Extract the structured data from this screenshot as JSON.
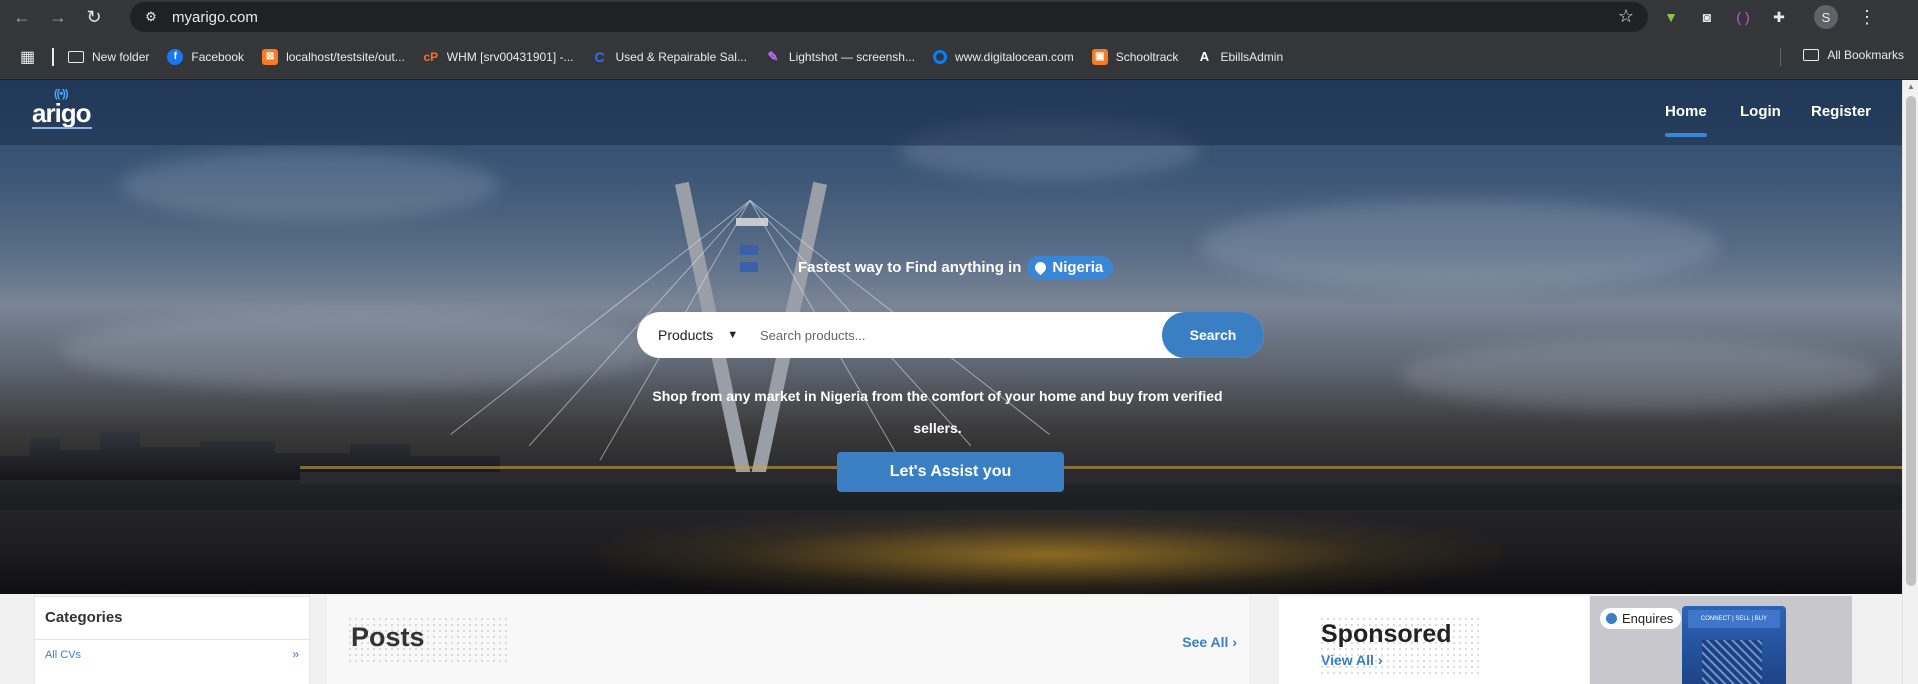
{
  "browser": {
    "url": "myarigo.com",
    "profile_initial": "S",
    "bookmarks": [
      {
        "label": "New folder"
      },
      {
        "label": "Facebook"
      },
      {
        "label": "localhost/testsite/out..."
      },
      {
        "label": "WHM [srv00431901] -..."
      },
      {
        "label": "Used & Repairable Sal..."
      },
      {
        "label": "Lightshot — screensh..."
      },
      {
        "label": "www.digitalocean.com"
      },
      {
        "label": "Schooltrack"
      },
      {
        "label": "EbillsAdmin"
      }
    ],
    "all_bookmarks_label": "All Bookmarks"
  },
  "site": {
    "logo_text": "arigo",
    "nav": [
      {
        "label": "Home"
      },
      {
        "label": "Login"
      },
      {
        "label": "Register"
      }
    ]
  },
  "hero": {
    "tagline": "Fastest way to Find anything in",
    "location": "Nigeria",
    "search_category": "Products",
    "search_placeholder": "Search products...",
    "search_button": "Search",
    "description": "Shop from any market in Nigeria from the comfort of your home and buy from verified sellers.",
    "assist_button": "Let's Assist you"
  },
  "categories": {
    "title": "Categories",
    "items": [
      {
        "label": "All CVs",
        "arrow": "»"
      }
    ]
  },
  "posts": {
    "title": "Posts",
    "see_all": "See All"
  },
  "sponsored": {
    "title": "Sponsored",
    "view_all": "View All",
    "ad_badge": "Enquires",
    "ad_kiosk_text": "CONNECT | SELL | BUY"
  },
  "colors": {
    "accent": "#3a7fc4",
    "chrome_bg": "#35363a"
  }
}
